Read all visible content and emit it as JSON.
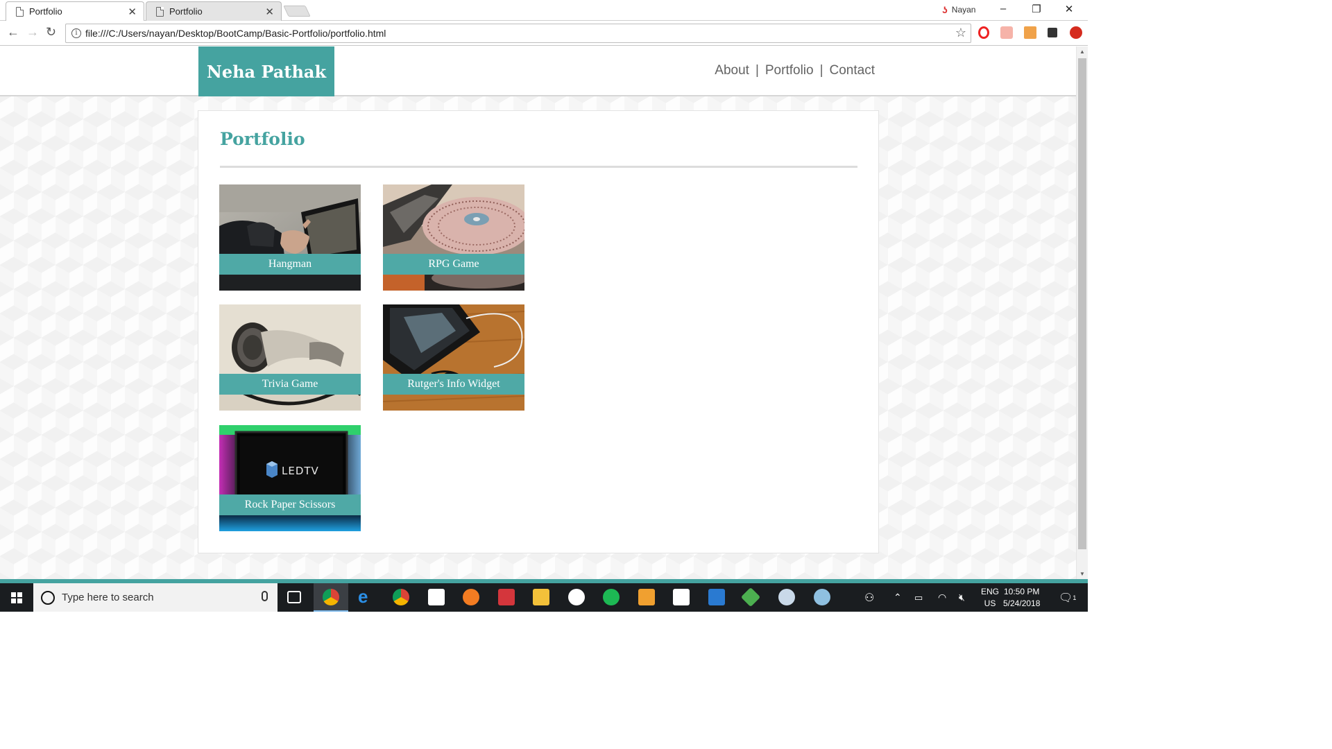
{
  "browser": {
    "tabs": [
      {
        "title": "Portfolio",
        "active": true
      },
      {
        "title": "Portfolio",
        "active": false
      }
    ],
    "profile_name": "Nayan",
    "url": "file:///C:/Users/nayan/Desktop/BootCamp/Basic-Portfolio/portfolio.html"
  },
  "site": {
    "brand": "Neha Pathak",
    "nav": [
      {
        "label": "About"
      },
      {
        "label": "Portfolio"
      },
      {
        "label": "Contact"
      }
    ],
    "nav_separator": "|",
    "page_title": "Portfolio",
    "projects": [
      {
        "title": "Hangman",
        "image": "hand-on-tablet-photo"
      },
      {
        "title": "RPG Game",
        "image": "turntable-photo"
      },
      {
        "title": "Trivia Game",
        "image": "earbud-photo"
      },
      {
        "title": "Rutger's Info Widget",
        "image": "phone-with-earphones-photo"
      },
      {
        "title": "Rock Paper Scissors",
        "image": "led-tv-photo"
      }
    ],
    "led_tv_logo_text": "LEDTV"
  },
  "taskbar": {
    "search_placeholder": "Type here to search",
    "language": "ENG",
    "region": "US",
    "time": "10:50 PM",
    "date": "5/24/2018",
    "notification_count": "1"
  },
  "colors": {
    "accent": "#45a3a0",
    "caption_bg": "#4fa9a6",
    "nav_text": "#636363"
  }
}
